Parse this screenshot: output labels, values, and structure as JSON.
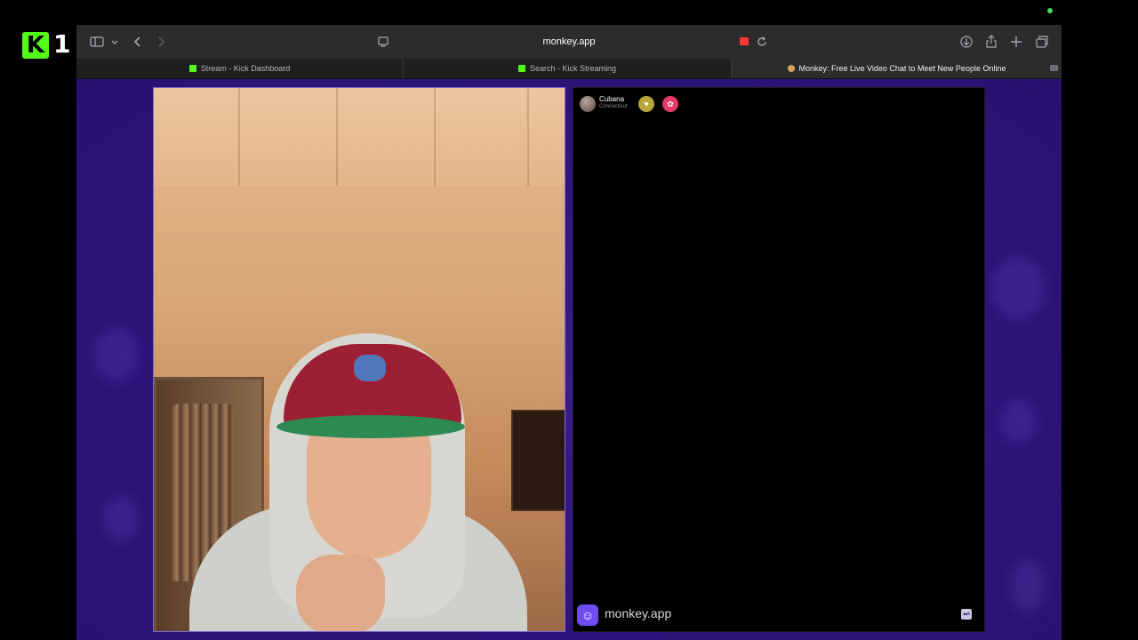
{
  "overlay": {
    "logo_icon": "kick-logo-icon",
    "logo_letter": "K",
    "count": "1",
    "accent": "#53fc18"
  },
  "browser": {
    "address_url": "monkey.app",
    "icons": [
      "sidebar-icon",
      "chevron-down-icon",
      "back-icon",
      "forward-icon",
      "page-menu-icon",
      "camera-icon",
      "reload-icon",
      "download-icon",
      "share-icon",
      "new-tab-icon",
      "tab-overview-icon"
    ],
    "tabs": [
      {
        "label": "Stream - Kick Dashboard",
        "favicon": "kick-icon",
        "active": false
      },
      {
        "label": "Search - Kick Streaming",
        "favicon": "kick-icon",
        "active": false
      },
      {
        "label": "Monkey: Free Live Video Chat to Meet New People Online",
        "favicon": "monkey-icon",
        "active": true
      }
    ]
  },
  "chat": {
    "partner_name": "Cubana",
    "partner_location": "Connecticut",
    "partner_icons": [
      "heart-icon",
      "gift-icon"
    ],
    "brand": "monkey.app",
    "brand_color": "#6d4df2",
    "background": "#2e147a"
  }
}
